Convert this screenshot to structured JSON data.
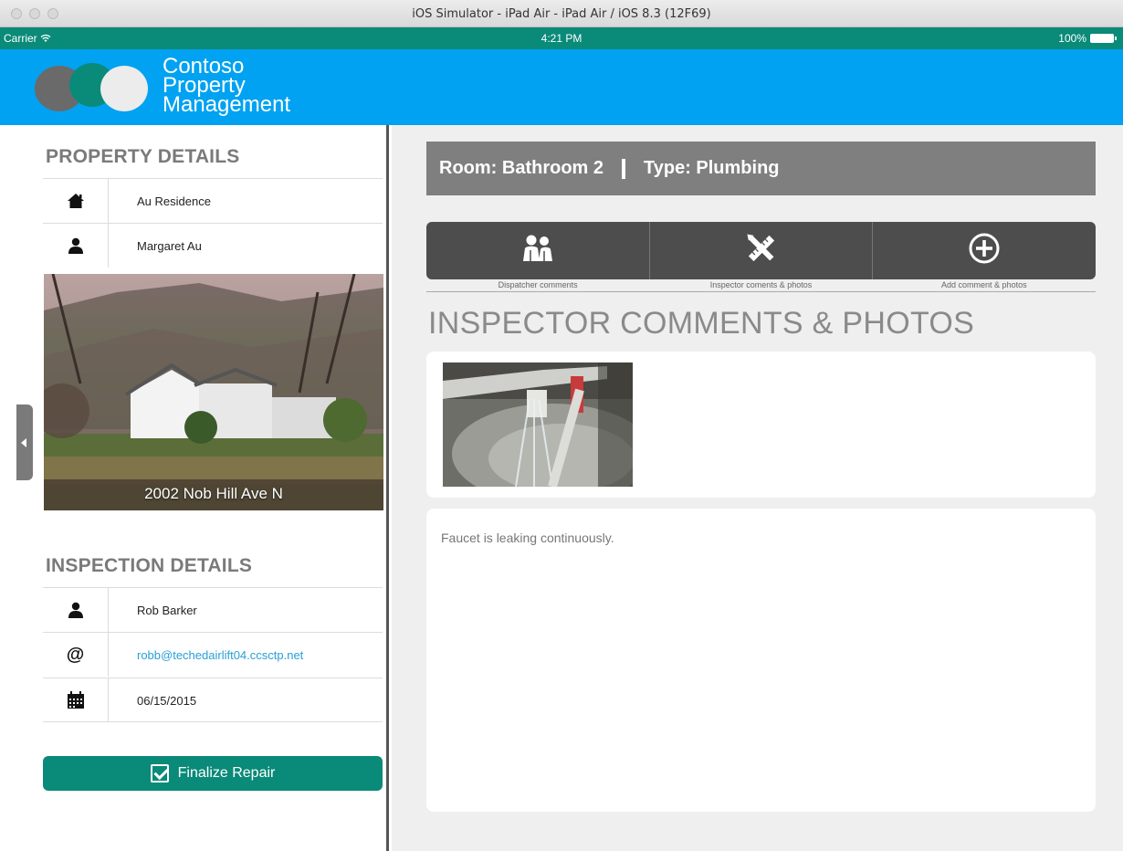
{
  "window": {
    "title": "iOS Simulator - iPad Air - iPad Air / iOS 8.3 (12F69)"
  },
  "statusbar": {
    "carrier": "Carrier",
    "time": "4:21 PM",
    "battery": "100%"
  },
  "brand": {
    "line1": "Contoso",
    "line2": "Property",
    "line3": "Management"
  },
  "colors": {
    "header": "#00a2f1",
    "accent": "#0a8a78",
    "toolbar": "#4d4d4d",
    "room_bar": "#7f7f7f"
  },
  "property": {
    "title": "PROPERTY DETAILS",
    "rows": [
      {
        "icon": "home-icon",
        "value": "Au Residence"
      },
      {
        "icon": "person-icon",
        "value": "Margaret Au"
      }
    ],
    "address": "2002 Nob Hill Ave N"
  },
  "inspection": {
    "title": "INSPECTION DETAILS",
    "rows": [
      {
        "icon": "person-icon",
        "value": "Rob Barker"
      },
      {
        "icon": "at-icon",
        "value": "robb@techedairlift04.ccsctp.net"
      },
      {
        "icon": "calendar-icon",
        "value": "06/15/2015"
      }
    ]
  },
  "finalize_label": "Finalize Repair",
  "room": {
    "room_text": "Room: Bathroom 2",
    "type_text": "Type: Plumbing"
  },
  "toolbar": {
    "buttons": [
      {
        "icon": "people-icon",
        "label": "Dispatcher comments"
      },
      {
        "icon": "tools-icon",
        "label": "Inspector coments & photos"
      },
      {
        "icon": "plus-circle-icon",
        "label": "Add comment & photos"
      }
    ]
  },
  "section_heading": "INSPECTOR COMMENTS & PHOTOS",
  "comment": "Faucet is leaking continuously."
}
